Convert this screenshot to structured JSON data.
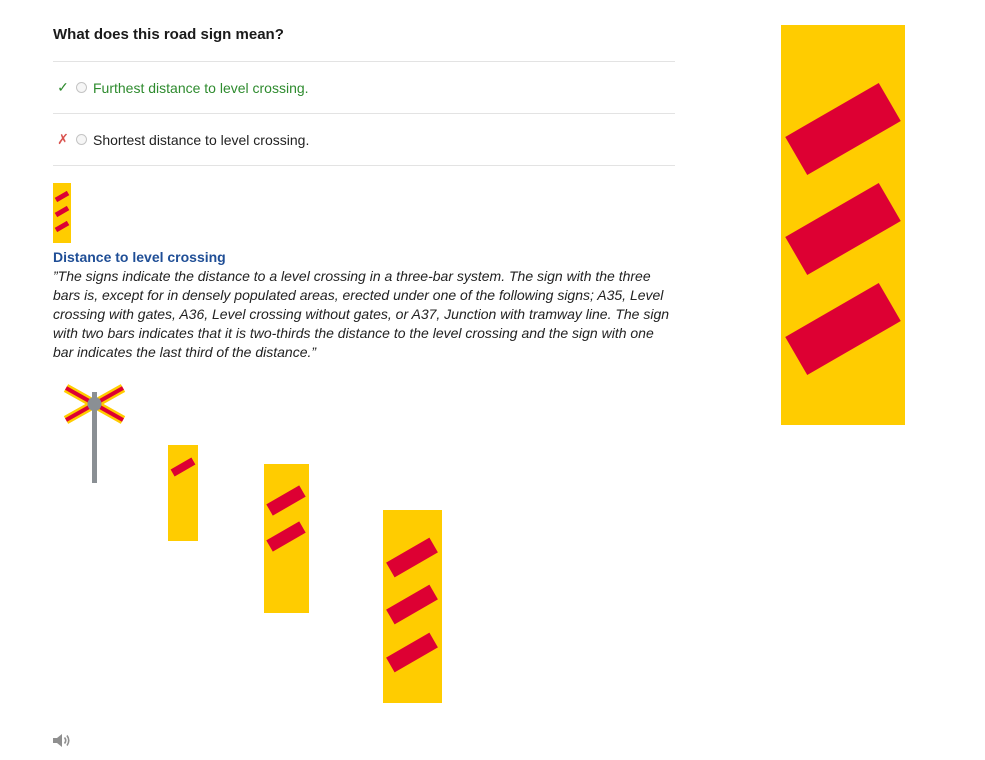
{
  "question": {
    "title": "What does this road sign mean?"
  },
  "answers": [
    {
      "mark": "✓",
      "status": "correct",
      "label": "Furthest distance to level crossing."
    },
    {
      "mark": "✗",
      "status": "wrong",
      "label": "Shortest distance to level crossing."
    }
  ],
  "explanation": {
    "title": "Distance to level crossing",
    "text": "”The signs indicate the distance to a level crossing in a three-bar system. The sign with the three bars is, except for in densely populated areas, erected under one of the following signs; A35, Level crossing with gates, A36, Level crossing without gates, or A37, Junction with tramway line. The sign with two bars indicates that it is two-thirds the distance to the level crossing and the sign with one bar indicates the last third of the distance.”"
  },
  "icons": {
    "speaker": "speaker-icon",
    "crossing": "level-crossing-icon",
    "sign": "distance-sign-icon"
  },
  "colors": {
    "sign_yellow": "#FFCC00",
    "bar_red": "#DD0033",
    "correct_green": "#2E8B2E",
    "wrong_red": "#D9534F",
    "title_blue": "#1F4E96"
  }
}
